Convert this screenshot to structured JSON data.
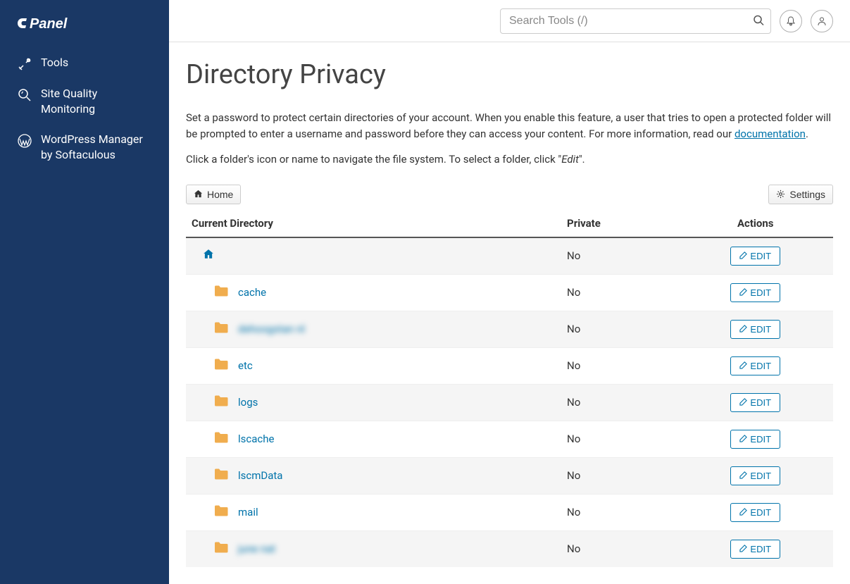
{
  "brand": "cPanel",
  "sidebar": {
    "items": [
      {
        "label": "Tools",
        "icon": "tools"
      },
      {
        "label": "Site Quality Monitoring",
        "icon": "magnify"
      },
      {
        "label": "WordPress Manager by Softaculous",
        "icon": "wordpress"
      }
    ]
  },
  "topbar": {
    "search_placeholder": "Search Tools (/)"
  },
  "page": {
    "title": "Directory Privacy",
    "intro_1a": "Set a password to protect certain directories of your account. When you enable this feature, a user that tries to open a protected folder will be prompted to enter a username and password before they can access your content. For more information, read our ",
    "intro_1_link": "documentation",
    "intro_1b": ".",
    "intro_2a": "Click a folder's icon or name to navigate the file system. To select a folder, click \"",
    "intro_2_italic": "Edit",
    "intro_2b": "\".",
    "home_btn": "Home",
    "settings_btn": "Settings",
    "columns": {
      "dir": "Current Directory",
      "private": "Private",
      "actions": "Actions"
    },
    "edit_label": "EDIT",
    "rows": [
      {
        "type": "home",
        "name": "",
        "private": "No",
        "blurred": false
      },
      {
        "type": "folder",
        "name": "cache",
        "private": "No",
        "blurred": false
      },
      {
        "type": "folder",
        "name": "dehoogstan nl",
        "private": "No",
        "blurred": true
      },
      {
        "type": "folder",
        "name": "etc",
        "private": "No",
        "blurred": false
      },
      {
        "type": "folder",
        "name": "logs",
        "private": "No",
        "blurred": false
      },
      {
        "type": "folder",
        "name": "lscache",
        "private": "No",
        "blurred": false
      },
      {
        "type": "folder",
        "name": "lscmData",
        "private": "No",
        "blurred": false
      },
      {
        "type": "folder",
        "name": "mail",
        "private": "No",
        "blurred": false
      },
      {
        "type": "folder",
        "name": "june nat",
        "private": "No",
        "blurred": true
      }
    ]
  }
}
